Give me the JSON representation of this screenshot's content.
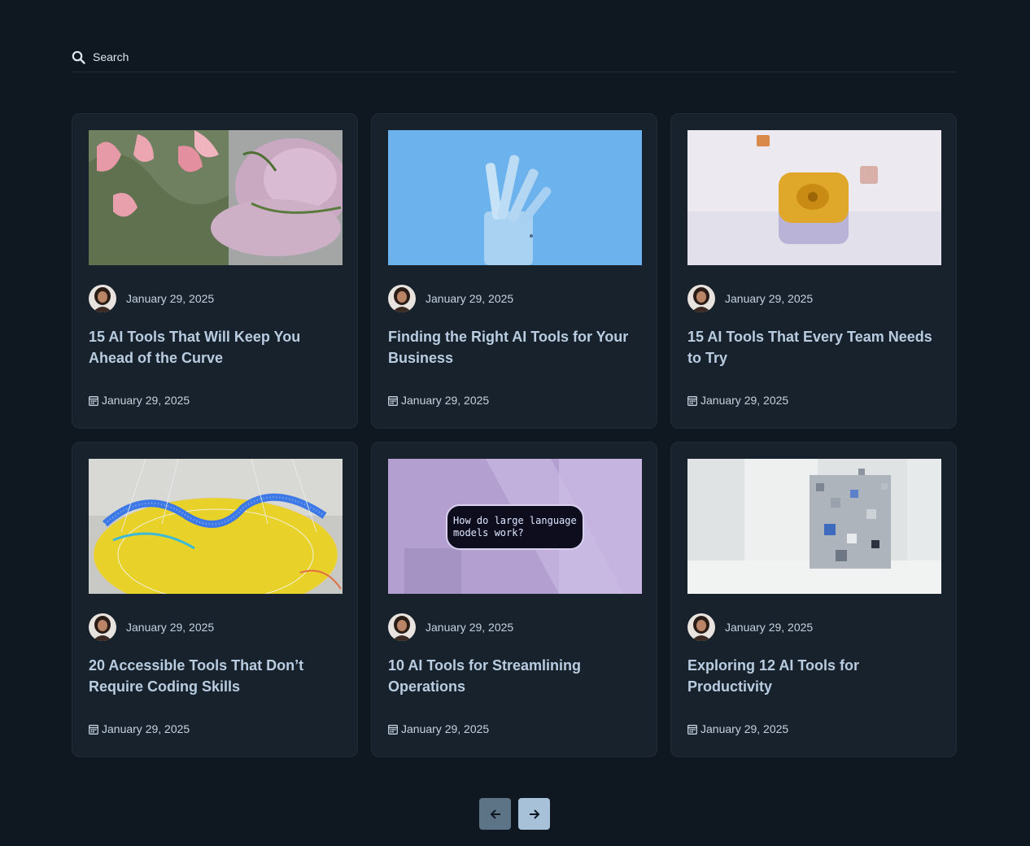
{
  "search": {
    "placeholder": "Search"
  },
  "posts": [
    {
      "meta_date": "January 29, 2025",
      "title": "15 AI Tools That Will Keep You Ahead of the Curve",
      "footer_date": "January 29, 2025"
    },
    {
      "meta_date": "January 29, 2025",
      "title": "Finding the Right AI Tools for Your Business",
      "footer_date": "January 29, 2025"
    },
    {
      "meta_date": "January 29, 2025",
      "title": "15 AI Tools That Every Team Needs to Try",
      "footer_date": "January 29, 2025"
    },
    {
      "meta_date": "January 29, 2025",
      "title": "20 Accessible Tools That Don’t Require Coding Skills",
      "footer_date": "January 29, 2025"
    },
    {
      "meta_date": "January 29, 2025",
      "title": "10 AI Tools for Streamlining Operations",
      "footer_date": "January 29, 2025"
    },
    {
      "meta_date": "January 29, 2025",
      "title": "Exploring 12 AI Tools for Productivity",
      "footer_date": "January 29, 2025"
    }
  ],
  "thumb5_text": {
    "line1": "How do large language",
    "line2": "models work?"
  },
  "pagination": {
    "prev_icon": "arrow-left-icon",
    "next_icon": "arrow-right-icon"
  },
  "colors": {
    "background": "#0f1720",
    "card": "#17222c",
    "title": "#b9cce0",
    "prev_button": "#5d7386",
    "next_button": "#a6c1d8"
  }
}
